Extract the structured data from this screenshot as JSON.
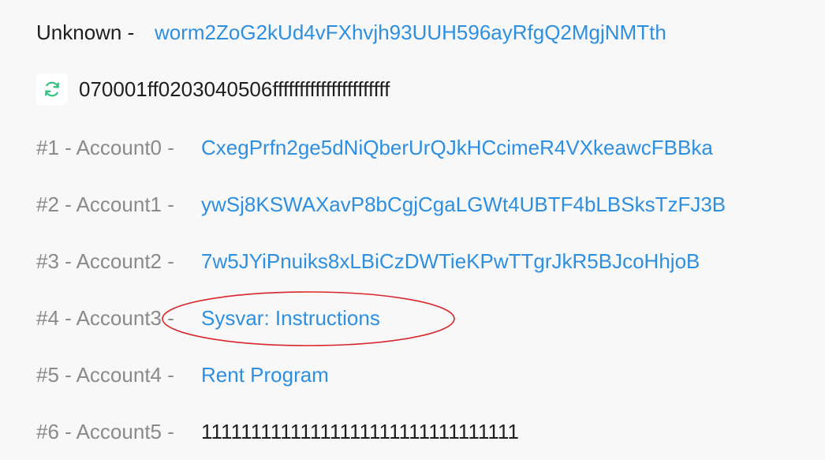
{
  "program": {
    "label": "Unknown -",
    "address": "worm2ZoG2kUd4vFXhvjh93UUH596ayRfgQ2MgjNMTth"
  },
  "instruction_data": {
    "icon": "refresh-icon",
    "value": "070001ff0203040506ffffffffffffffffffffff"
  },
  "accounts": [
    {
      "label": "#1 - Account0 -",
      "value": "CxegPrfn2ge5dNiQberUrQJkHCcimeR4VXkeawcFBBka"
    },
    {
      "label": "#2 - Account1 -",
      "value": "ywSj8KSWAXavP8bCgjCgaLGWt4UBTF4bLBSksTzFJ3B"
    },
    {
      "label": "#3 - Account2 -",
      "value": "7w5JYiPnuiks8xLBiCzDWTieKPwTTgrJkR5BJcoHhjoB"
    },
    {
      "label": "#4 - Account3 -",
      "value": "Sysvar: Instructions"
    },
    {
      "label": "#5 - Account4 -",
      "value": "Rent Program"
    },
    {
      "label": "#6 - Account5 -",
      "value": "11111111111111111111111111111111"
    }
  ],
  "colors": {
    "background": "#f8f8f8",
    "link": "#2f8fdf",
    "muted": "#8a8a8a",
    "icon": "#2ec27e",
    "annotation": "#d9262b"
  }
}
